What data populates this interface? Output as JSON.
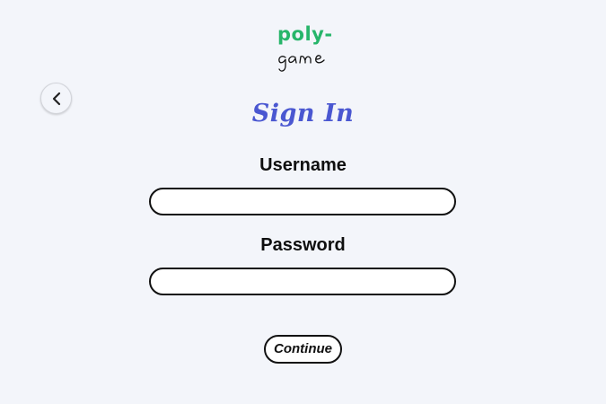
{
  "logo": {
    "line1": "poly-",
    "line2": "game",
    "line1_color": "#27b56a",
    "line2_color": "#111111"
  },
  "nav": {
    "back_icon": "chevron-left-icon"
  },
  "form": {
    "title": "Sign In",
    "title_color": "#4a57d1",
    "username_label": "Username",
    "username_value": "",
    "password_label": "Password",
    "password_value": "",
    "continue_label": "Continue"
  },
  "theme": {
    "background": "#f3f5fa",
    "border": "#111111"
  }
}
